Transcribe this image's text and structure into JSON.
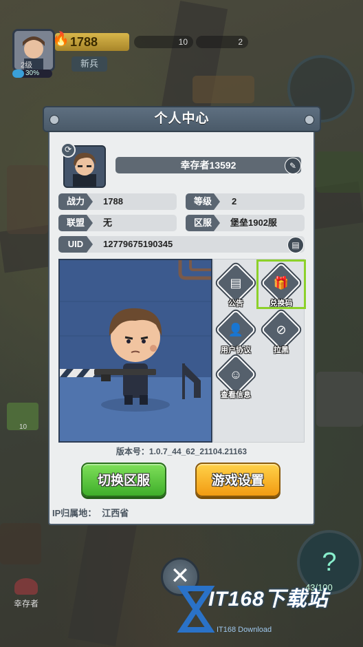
{
  "hud": {
    "level": "2级",
    "exp_percent": "30%",
    "exp_fraction": 0.3,
    "power": "1788",
    "rank": "新兵",
    "res_a": "10",
    "res_b": "2",
    "count": "43/100",
    "survivor_label": "幸存者",
    "box_count": "10"
  },
  "dialog": {
    "title": "个人中心",
    "player_name": "幸存者13592",
    "fields": {
      "power": {
        "label": "战力",
        "value": "1788"
      },
      "level": {
        "label": "等级",
        "value": "2"
      },
      "alliance": {
        "label": "联盟",
        "value": "无"
      },
      "server": {
        "label": "区服",
        "value": "堡垒1902服"
      },
      "uid": {
        "label": "UID",
        "value": "12779675190345"
      }
    },
    "actions": {
      "notice": "公告",
      "redeem": "兑换码",
      "agreement": "用户协议",
      "blacklist": "拉黑",
      "view_info": "查看信息"
    },
    "version": "版本号：1.0.7_44_62_21104.21163",
    "switch_server": "切换区服",
    "game_settings": "游戏设置",
    "ip_label": "IP归属地：",
    "ip_value": "江西省"
  },
  "watermark": {
    "text": "IT168下载站",
    "sub": "IT168 Download"
  },
  "colors": {
    "accent_green": "#8cd12a",
    "button_green": "#3fae2a",
    "button_orange": "#f29b12",
    "header": "#4a5a69"
  }
}
